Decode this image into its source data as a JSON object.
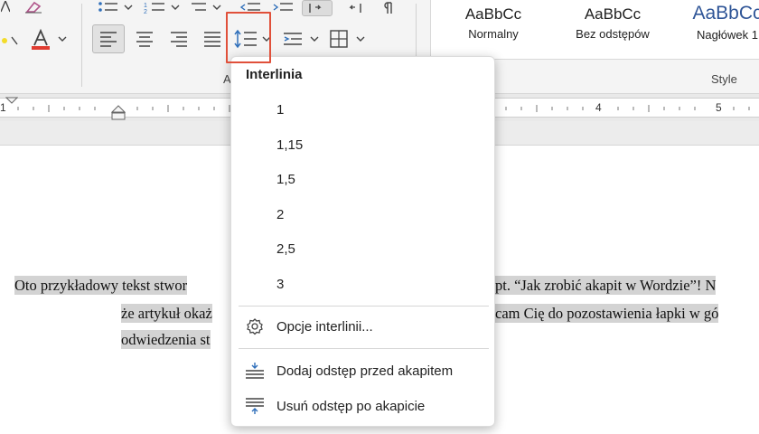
{
  "ribbon": {
    "paragraph_group_label": "A",
    "styles_group_label": "Style",
    "styles": [
      {
        "sample": "AaBbCc",
        "name": "Normalny"
      },
      {
        "sample": "AaBbCc",
        "name": "Bez odstępów"
      },
      {
        "sample": "AaBbCc",
        "name": "Nagłówek 1"
      }
    ],
    "font_color": "#e03c31"
  },
  "ruler": {
    "numbers": [
      "1",
      "4",
      "5"
    ]
  },
  "document": {
    "line1_left": "Oto przykładowy tekst stwor",
    "line1_right": "pt. “Jak zrobić akapit w Wordzie”! N",
    "line2_left": "że artykuł okaż",
    "line2_right": "cam Cię do pozostawienia łapki w gó",
    "line3_left": "odwiedzenia st"
  },
  "line_spacing_menu": {
    "title": "Interlinia",
    "options": [
      "1",
      "1,15",
      "1,5",
      "2",
      "2,5",
      "3"
    ],
    "line_spacing_options_label": "Opcje interlinii...",
    "add_space_before_label": "Dodaj odstęp przed akapitem",
    "remove_space_after_label": "Usuń odstęp po akapicie"
  },
  "colors": {
    "highlight_box": "#e0503a",
    "heading_style": "#2f5597",
    "text_highlight": "#d3d3d3"
  }
}
